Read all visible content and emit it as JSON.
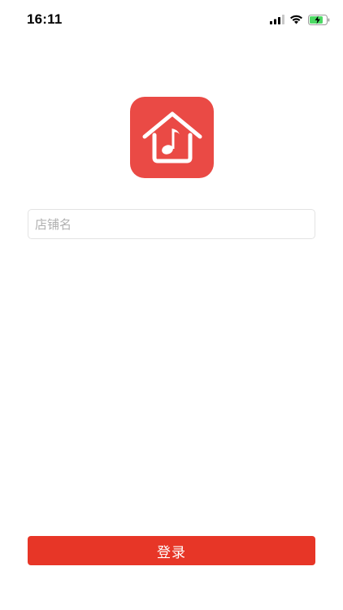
{
  "status_bar": {
    "time": "16:11",
    "battery_color": "#4cd964"
  },
  "app": {
    "brand_color": "#ea4a45",
    "logo_icon": "house-music-note-icon"
  },
  "form": {
    "shop_name": {
      "value": "",
      "placeholder": "店铺名"
    },
    "login_label": "登录",
    "login_color": "#e73627"
  }
}
